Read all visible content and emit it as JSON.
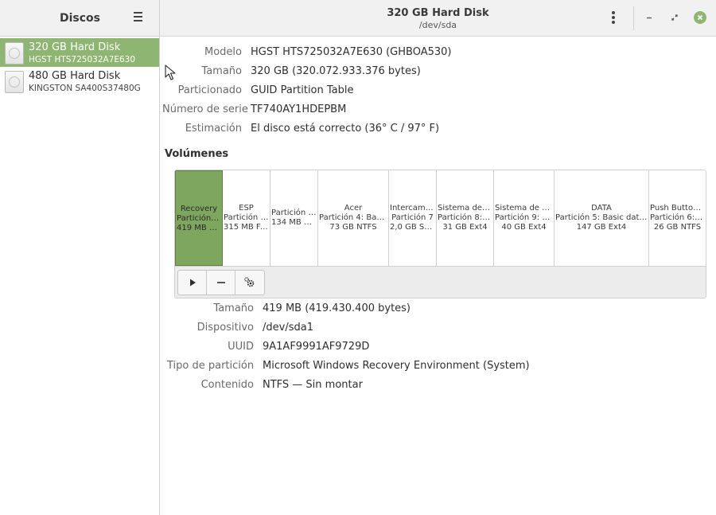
{
  "sidebar": {
    "title": "Discos",
    "disks": [
      {
        "name": "320 GB Hard Disk",
        "model": "HGST HTS725032A7E630",
        "selected": true
      },
      {
        "name": "480 GB Hard Disk",
        "model": "KINGSTON SA400S37480G",
        "selected": false
      }
    ]
  },
  "header": {
    "title": "320 GB Hard Disk",
    "subtitle": "/dev/sda"
  },
  "disk_info": [
    {
      "label": "Modelo",
      "value": "HGST HTS725032A7E630 (GHBOA530)"
    },
    {
      "label": "Tamaño",
      "value": "320 GB (320.072.933.376 bytes)"
    },
    {
      "label": "Particionado",
      "value": "GUID Partition Table"
    },
    {
      "label": "Número de serie",
      "value": "TF740AY1HDEPBM"
    },
    {
      "label": "Estimación",
      "value": "El disco está correcto (36° C / 97° F)"
    }
  ],
  "volumes_title": "Volúmenes",
  "volumes": [
    {
      "l1": "Recovery",
      "l2": "Partición 1…",
      "l3": "419 MB NT…",
      "selected": true
    },
    {
      "l1": "ESP",
      "l2": "Partición 2…",
      "l3": "315 MB FAT",
      "selected": false
    },
    {
      "l1": "",
      "l2": "Partición 3…",
      "l3": "134 MB Un…",
      "selected": false
    },
    {
      "l1": "Acer",
      "l2": "Partición 4: Basi…",
      "l3": "73 GB NTFS",
      "selected": false
    },
    {
      "l1": "Intercambio",
      "l2": "Partición 7",
      "l3": "2,0 GB Swap",
      "selected": false
    },
    {
      "l1": "Sistema de a…",
      "l2": "Partición 8: d…",
      "l3": "31 GB Ext4",
      "selected": false
    },
    {
      "l1": "Sistema de ar…",
      "l2": "Partición 9: h…",
      "l3": "40 GB Ext4",
      "selected": false
    },
    {
      "l1": "DATA",
      "l2": "Partición 5: Basic data …",
      "l3": "147 GB Ext4",
      "selected": false
    },
    {
      "l1": "Push Button …",
      "l2": "Partición 6: B…",
      "l3": "26 GB NTFS",
      "selected": false
    }
  ],
  "volume_tools": [
    {
      "name": "play-icon",
      "glyph": "▶"
    },
    {
      "name": "minus-icon",
      "glyph": "—"
    },
    {
      "name": "gears-icon",
      "glyph": "⚙"
    }
  ],
  "partition_info": [
    {
      "label": "Tamaño",
      "value": "419 MB (419.430.400 bytes)"
    },
    {
      "label": "Dispositivo",
      "value": "/dev/sda1"
    },
    {
      "label": "UUID",
      "value": "9A1AF9991AF9729D"
    },
    {
      "label": "Tipo de partición",
      "value": "Microsoft Windows Recovery Environment (System)"
    },
    {
      "label": "Contenido",
      "value": "NTFS — Sin montar"
    }
  ],
  "colors": {
    "accent": "#8fb573",
    "selected_volume": "#7fa65f"
  }
}
